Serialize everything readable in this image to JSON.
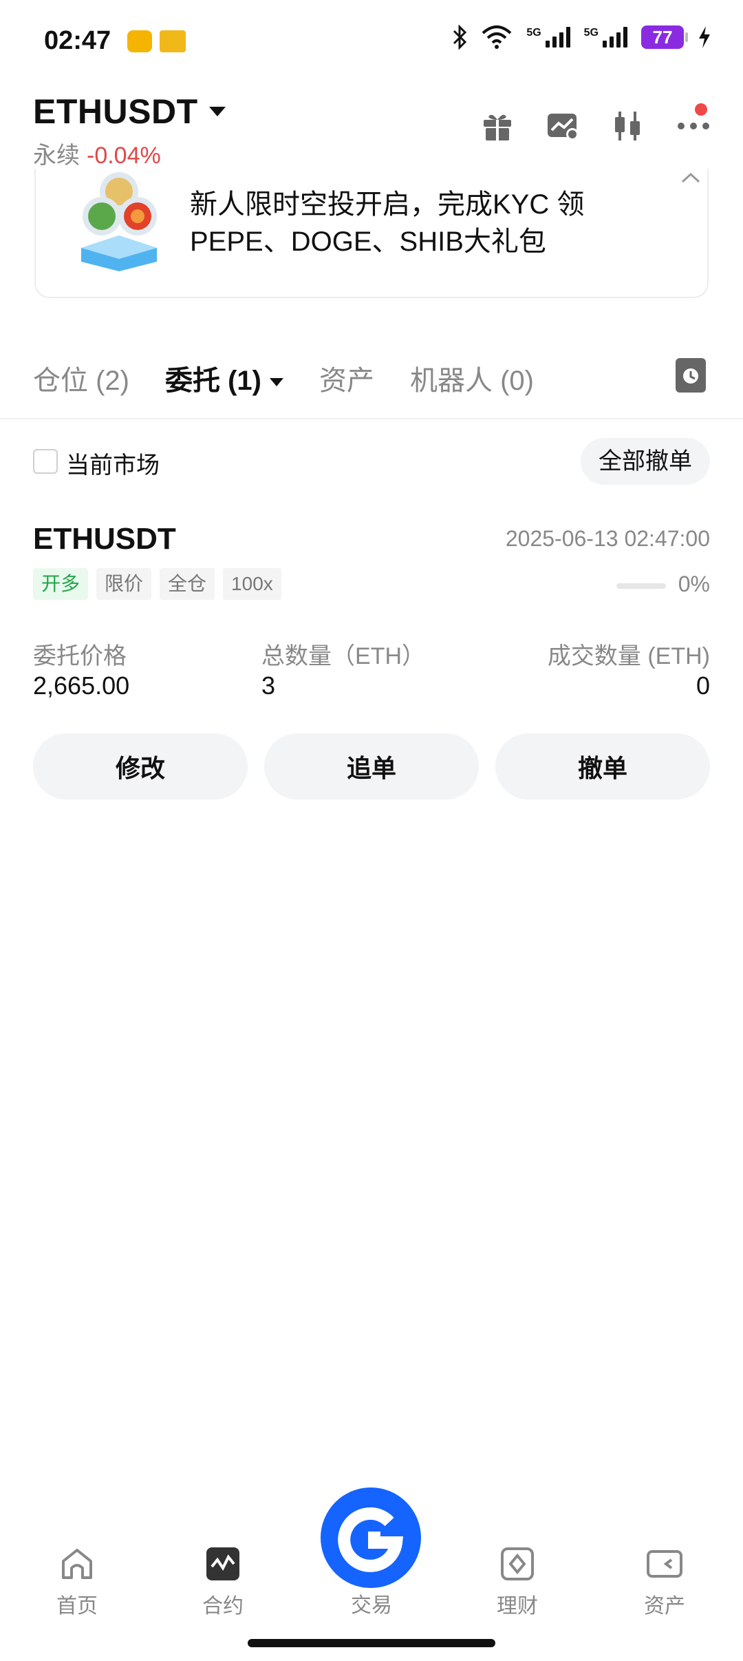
{
  "status": {
    "time": "02:47",
    "battery": "77",
    "net1": "5G",
    "net2": "5G"
  },
  "header": {
    "symbol": "ETHUSDT",
    "type": "永续",
    "change": "-0.04%"
  },
  "banner": {
    "line1": "新人限时空投开启，完成KYC 领",
    "line2": "PEPE、DOGE、SHIB大礼包"
  },
  "tabs": [
    {
      "label": "仓位 (2)"
    },
    {
      "label": "委托 (1)"
    },
    {
      "label": "资产"
    },
    {
      "label": "机器人 (0)"
    }
  ],
  "filter": {
    "current_market": "当前市场",
    "cancel_all": "全部撤单"
  },
  "order": {
    "symbol": "ETHUSDT",
    "time": "2025-06-13 02:47:00",
    "tags": [
      "开多",
      "限价",
      "全仓",
      "100x"
    ],
    "fill_pct": "0%",
    "price_label": "委托价格",
    "price": "2,665.00",
    "qty_label": "总数量（ETH）",
    "qty": "3",
    "filled_label": "成交数量 (ETH)",
    "filled": "0",
    "buttons": {
      "modify": "修改",
      "chase": "追单",
      "cancel": "撤单"
    }
  },
  "nav": {
    "home": "首页",
    "futures": "合约",
    "trade": "交易",
    "finance": "理财",
    "assets": "资产"
  },
  "colors": {
    "accent": "#1564ff",
    "negative": "#e04848",
    "long": "#22a54a"
  }
}
